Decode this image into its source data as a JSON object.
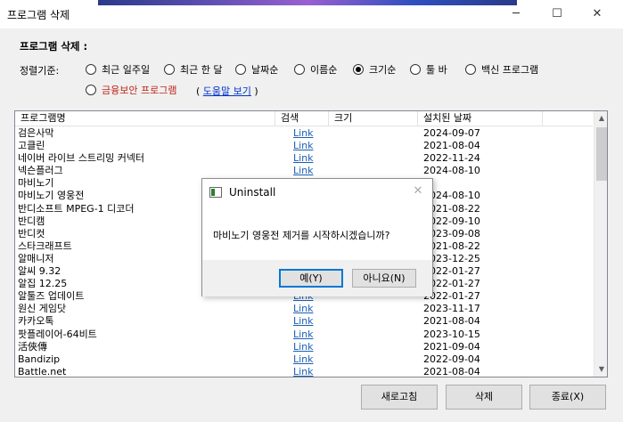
{
  "window": {
    "title": "프로그램 삭제",
    "minimize": "─",
    "maximize": "☐",
    "close": "✕"
  },
  "section_label": "프로그램 삭제 :",
  "sort": {
    "label": "정렬기준:",
    "options": [
      "최근 일주일",
      "최근 한 달",
      "날짜순",
      "이름순",
      "크기순",
      "툴 바",
      "백신 프로그램",
      "금융보안 프로그램"
    ],
    "selected": "크기순",
    "help_open": "(",
    "help_link": "도움말 보기",
    "help_close": ")"
  },
  "table": {
    "headers": [
      "프로그램명",
      "검색",
      "크기",
      "설치된 날짜"
    ],
    "rows": [
      {
        "name": "검은사막",
        "link": "Link",
        "date": "2024-09-07"
      },
      {
        "name": "고클린",
        "link": "Link",
        "date": "2021-08-04"
      },
      {
        "name": "네이버 라이브 스트리밍 커넥터",
        "link": "Link",
        "date": "2022-11-24"
      },
      {
        "name": "넥슨플러그",
        "link": "Link",
        "date": "2024-08-10"
      },
      {
        "name": "마비노기",
        "link": "",
        "date": ""
      },
      {
        "name": "마비노기 영웅전",
        "link": "",
        "date": "2024-08-10"
      },
      {
        "name": "반디소프트 MPEG-1 디코더",
        "link": "",
        "date": "2021-08-22"
      },
      {
        "name": "반디캠",
        "link": "",
        "date": "2022-09-10"
      },
      {
        "name": "반디컷",
        "link": "",
        "date": "2023-09-08"
      },
      {
        "name": "스타크래프트",
        "link": "",
        "date": "2021-08-22"
      },
      {
        "name": "알매니저",
        "link": "",
        "date": "2023-12-25"
      },
      {
        "name": "알씨 9.32",
        "link": "",
        "date": "2022-01-27"
      },
      {
        "name": "알집 12.25",
        "link": "",
        "date": "2022-01-27"
      },
      {
        "name": "알툴즈 업데이트",
        "link": "Link",
        "date": "2022-01-27"
      },
      {
        "name": "원신 게임닷",
        "link": "Link",
        "date": "2023-11-17"
      },
      {
        "name": "카카오톡",
        "link": "Link",
        "date": "2021-08-04"
      },
      {
        "name": "팟플레이어-64비트",
        "link": "Link",
        "date": "2023-10-15"
      },
      {
        "name": "活俠傳",
        "link": "Link",
        "date": "2021-09-04"
      },
      {
        "name": "Bandizip",
        "link": "Link",
        "date": "2022-09-04"
      },
      {
        "name": "Battle.net",
        "link": "Link",
        "date": "2021-08-04"
      }
    ]
  },
  "buttons": {
    "refresh": "새로고침",
    "delete": "삭제",
    "exit": "종료(X)"
  },
  "dialog": {
    "title": "Uninstall",
    "message": "마비노기 영웅전 제거를 시작하시겠습니까?",
    "yes": "예(Y)",
    "no": "아니요(N)"
  }
}
